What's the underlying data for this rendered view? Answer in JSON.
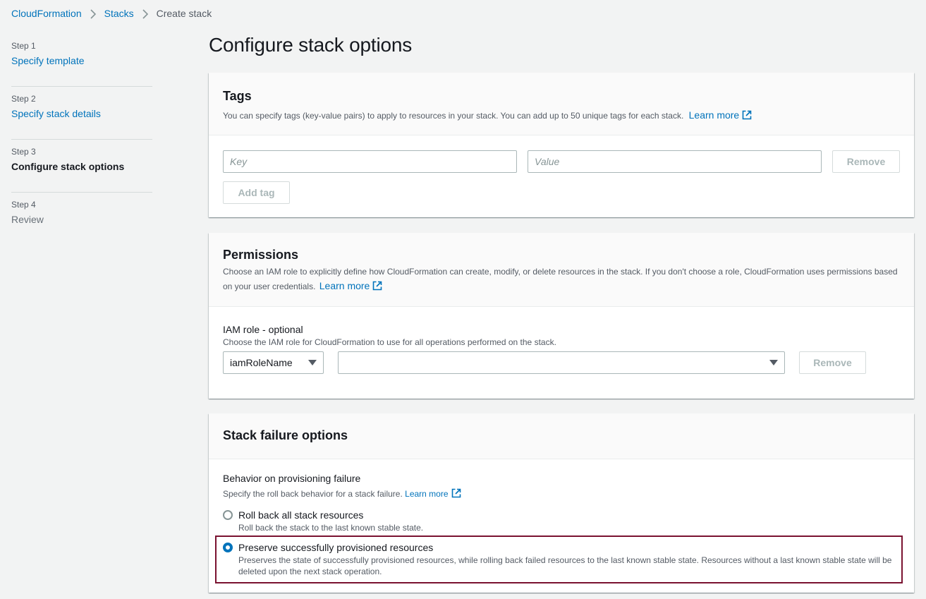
{
  "breadcrumb": {
    "items": [
      "CloudFormation",
      "Stacks",
      "Create stack"
    ]
  },
  "steps": [
    {
      "number": "Step 1",
      "title": "Specify template",
      "state": "link"
    },
    {
      "number": "Step 2",
      "title": "Specify stack details",
      "state": "link"
    },
    {
      "number": "Step 3",
      "title": "Configure stack options",
      "state": "current"
    },
    {
      "number": "Step 4",
      "title": "Review",
      "state": "disabled"
    }
  ],
  "page_title": "Configure stack options",
  "tags": {
    "title": "Tags",
    "description": "You can specify tags (key-value pairs) to apply to resources in your stack. You can add up to 50 unique tags for each stack.",
    "learn_more": "Learn more",
    "key_placeholder": "Key",
    "value_placeholder": "Value",
    "remove_label": "Remove",
    "add_tag_label": "Add tag"
  },
  "permissions": {
    "title": "Permissions",
    "description": "Choose an IAM role to explicitly define how CloudFormation can create, modify, or delete resources in the stack. If you don't choose a role, CloudFormation uses permissions based on your user credentials.",
    "learn_more": "Learn more",
    "iam_label": "IAM role - optional",
    "iam_desc": "Choose the IAM role for CloudFormation to use for all operations performed on the stack.",
    "role_type_value": "iamRoleName",
    "role_value": "",
    "remove_label": "Remove"
  },
  "failure": {
    "title": "Stack failure options",
    "behavior_label": "Behavior on provisioning failure",
    "behavior_desc": "Specify the roll back behavior for a stack failure.",
    "learn_more": "Learn more",
    "options": [
      {
        "label": "Roll back all stack resources",
        "desc": "Roll back the stack to the last known stable state.",
        "checked": false
      },
      {
        "label": "Preserve successfully provisioned resources",
        "desc": "Preserves the state of successfully provisioned resources, while rolling back failed resources to the last known stable state. Resources without a last known stable state will be deleted upon the next stack operation.",
        "checked": true
      }
    ]
  },
  "colors": {
    "link": "#0073bb",
    "highlight": "#7a1230",
    "background": "#f2f3f3"
  }
}
